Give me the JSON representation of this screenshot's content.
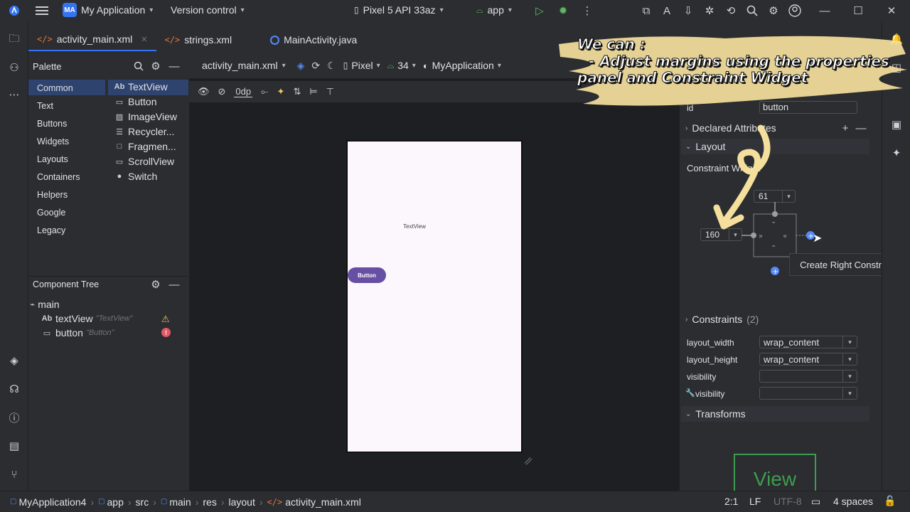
{
  "topbar": {
    "project_badge": "MA",
    "project_name": "My Application",
    "vcs": "Version control",
    "device": "Pixel 5 API 33az",
    "run_config": "app"
  },
  "tabs": [
    {
      "label": "activity_main.xml"
    },
    {
      "label": "strings.xml"
    },
    {
      "label": "MainActivity.java"
    }
  ],
  "palette": {
    "title": "Palette",
    "categories": [
      "Common",
      "Text",
      "Buttons",
      "Widgets",
      "Layouts",
      "Containers",
      "Helpers",
      "Google",
      "Legacy"
    ],
    "items": [
      {
        "glyph": "Ab",
        "label": "TextView"
      },
      {
        "glyph": "▭",
        "label": "Button"
      },
      {
        "glyph": "▨",
        "label": "ImageView"
      },
      {
        "glyph": "☰",
        "label": "Recycler..."
      },
      {
        "glyph": "□",
        "label": "Fragmen..."
      },
      {
        "glyph": "▭",
        "label": "ScrollView"
      },
      {
        "glyph": "●",
        "label": "Switch"
      }
    ]
  },
  "component_tree": {
    "title": "Component Tree",
    "root": "main",
    "children": [
      {
        "glyph": "Ab",
        "name": "textView",
        "sub": "\"TextView\""
      },
      {
        "glyph": "▭",
        "name": "button",
        "sub": "\"Button\""
      }
    ]
  },
  "design_toolbar": {
    "file": "activity_main.xml",
    "device": "Pixel",
    "api": "34",
    "theme": "MyApplication",
    "margin": "0dp"
  },
  "preview": {
    "textview": "TextView",
    "button": "Button"
  },
  "attributes": {
    "id_label": "id",
    "id_value": "button",
    "declared": "Declared Attributes",
    "layout": "Layout",
    "constraint_widget": "Constraint Widget",
    "top_margin": "61",
    "left_margin": "160",
    "constraints": "Constraints",
    "constraints_count": "(2)",
    "rows": [
      {
        "label": "layout_width",
        "value": "wrap_content"
      },
      {
        "label": "layout_height",
        "value": "wrap_content"
      },
      {
        "label": "visibility",
        "value": ""
      },
      {
        "label": "visibility",
        "value": ""
      }
    ],
    "transforms": "Transforms",
    "view_label": "View"
  },
  "tooltip": "Create Right Constraint",
  "annotation": {
    "line1": "We can :",
    "line2": "- Adjust margins using the properties",
    "line3": "panel and Constraint Widget"
  },
  "statusbar": {
    "crumbs": [
      "MyApplication4",
      "app",
      "src",
      "main",
      "res",
      "layout",
      "activity_main.xml"
    ],
    "position": "2:1",
    "line_sep": "LF",
    "encoding": "UTF-8",
    "indent": "4 spaces"
  }
}
